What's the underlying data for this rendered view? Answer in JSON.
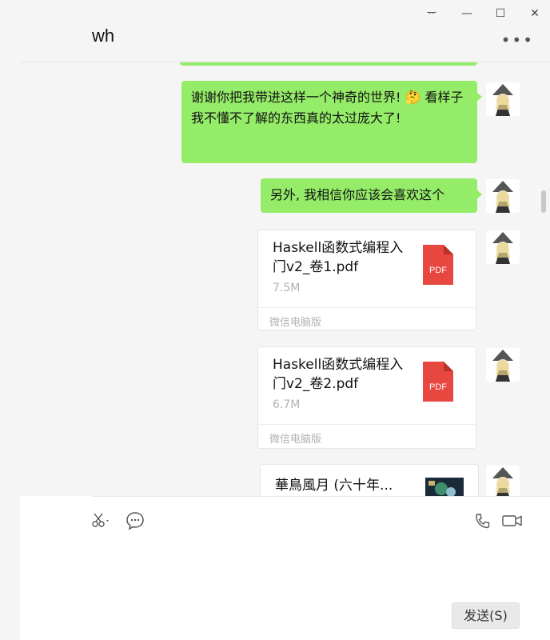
{
  "window": {
    "title": "wh",
    "pin_label": "ᅲ",
    "minimize_label": "—",
    "maximize_label": "☐",
    "close_label": "✕",
    "more_label": "•••"
  },
  "messages": [
    {
      "type": "text",
      "text": "谢谢你把我带进这样一个神奇的世界! 🤔 看样子我不懂不了解的东西真的太过庞大了!"
    },
    {
      "type": "text",
      "text": "另外, 我相信你应该会喜欢这个"
    },
    {
      "type": "file",
      "name": "Haskell函数式编程入门v2_卷1.pdf",
      "size": "7.5M",
      "source": "微信电脑版",
      "icon_label": "PDF"
    },
    {
      "type": "file",
      "name": "Haskell函数式编程入门v2_卷2.pdf",
      "size": "6.7M",
      "source": "微信电脑版",
      "icon_label": "PDF"
    },
    {
      "type": "link",
      "title": "華鳥風月 (六十年..."
    }
  ],
  "input": {
    "send_label": "发送(S)"
  },
  "colors": {
    "bubble": "#95ec69",
    "pdf_red": "#e8473f",
    "background": "#f5f5f5"
  }
}
